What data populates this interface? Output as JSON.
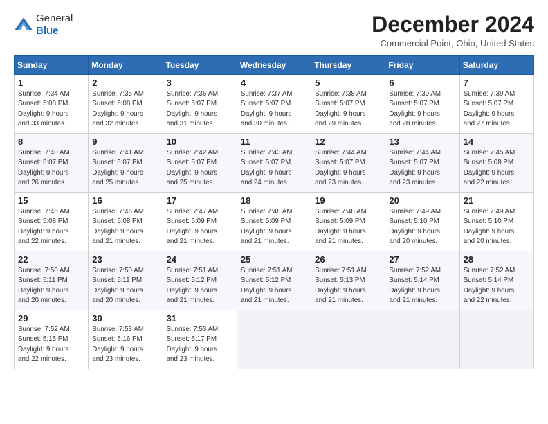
{
  "header": {
    "logo_general": "General",
    "logo_blue": "Blue",
    "month_title": "December 2024",
    "location": "Commercial Point, Ohio, United States"
  },
  "days_of_week": [
    "Sunday",
    "Monday",
    "Tuesday",
    "Wednesday",
    "Thursday",
    "Friday",
    "Saturday"
  ],
  "weeks": [
    [
      {
        "day": 1,
        "info": "Sunrise: 7:34 AM\nSunset: 5:08 PM\nDaylight: 9 hours\nand 33 minutes."
      },
      {
        "day": 2,
        "info": "Sunrise: 7:35 AM\nSunset: 5:08 PM\nDaylight: 9 hours\nand 32 minutes."
      },
      {
        "day": 3,
        "info": "Sunrise: 7:36 AM\nSunset: 5:07 PM\nDaylight: 9 hours\nand 31 minutes."
      },
      {
        "day": 4,
        "info": "Sunrise: 7:37 AM\nSunset: 5:07 PM\nDaylight: 9 hours\nand 30 minutes."
      },
      {
        "day": 5,
        "info": "Sunrise: 7:38 AM\nSunset: 5:07 PM\nDaylight: 9 hours\nand 29 minutes."
      },
      {
        "day": 6,
        "info": "Sunrise: 7:39 AM\nSunset: 5:07 PM\nDaylight: 9 hours\nand 28 minutes."
      },
      {
        "day": 7,
        "info": "Sunrise: 7:39 AM\nSunset: 5:07 PM\nDaylight: 9 hours\nand 27 minutes."
      }
    ],
    [
      {
        "day": 8,
        "info": "Sunrise: 7:40 AM\nSunset: 5:07 PM\nDaylight: 9 hours\nand 26 minutes."
      },
      {
        "day": 9,
        "info": "Sunrise: 7:41 AM\nSunset: 5:07 PM\nDaylight: 9 hours\nand 25 minutes."
      },
      {
        "day": 10,
        "info": "Sunrise: 7:42 AM\nSunset: 5:07 PM\nDaylight: 9 hours\nand 25 minutes."
      },
      {
        "day": 11,
        "info": "Sunrise: 7:43 AM\nSunset: 5:07 PM\nDaylight: 9 hours\nand 24 minutes."
      },
      {
        "day": 12,
        "info": "Sunrise: 7:44 AM\nSunset: 5:07 PM\nDaylight: 9 hours\nand 23 minutes."
      },
      {
        "day": 13,
        "info": "Sunrise: 7:44 AM\nSunset: 5:07 PM\nDaylight: 9 hours\nand 23 minutes."
      },
      {
        "day": 14,
        "info": "Sunrise: 7:45 AM\nSunset: 5:08 PM\nDaylight: 9 hours\nand 22 minutes."
      }
    ],
    [
      {
        "day": 15,
        "info": "Sunrise: 7:46 AM\nSunset: 5:08 PM\nDaylight: 9 hours\nand 22 minutes."
      },
      {
        "day": 16,
        "info": "Sunrise: 7:46 AM\nSunset: 5:08 PM\nDaylight: 9 hours\nand 21 minutes."
      },
      {
        "day": 17,
        "info": "Sunrise: 7:47 AM\nSunset: 5:09 PM\nDaylight: 9 hours\nand 21 minutes."
      },
      {
        "day": 18,
        "info": "Sunrise: 7:48 AM\nSunset: 5:09 PM\nDaylight: 9 hours\nand 21 minutes."
      },
      {
        "day": 19,
        "info": "Sunrise: 7:48 AM\nSunset: 5:09 PM\nDaylight: 9 hours\nand 21 minutes."
      },
      {
        "day": 20,
        "info": "Sunrise: 7:49 AM\nSunset: 5:10 PM\nDaylight: 9 hours\nand 20 minutes."
      },
      {
        "day": 21,
        "info": "Sunrise: 7:49 AM\nSunset: 5:10 PM\nDaylight: 9 hours\nand 20 minutes."
      }
    ],
    [
      {
        "day": 22,
        "info": "Sunrise: 7:50 AM\nSunset: 5:11 PM\nDaylight: 9 hours\nand 20 minutes."
      },
      {
        "day": 23,
        "info": "Sunrise: 7:50 AM\nSunset: 5:11 PM\nDaylight: 9 hours\nand 20 minutes."
      },
      {
        "day": 24,
        "info": "Sunrise: 7:51 AM\nSunset: 5:12 PM\nDaylight: 9 hours\nand 21 minutes."
      },
      {
        "day": 25,
        "info": "Sunrise: 7:51 AM\nSunset: 5:12 PM\nDaylight: 9 hours\nand 21 minutes."
      },
      {
        "day": 26,
        "info": "Sunrise: 7:51 AM\nSunset: 5:13 PM\nDaylight: 9 hours\nand 21 minutes."
      },
      {
        "day": 27,
        "info": "Sunrise: 7:52 AM\nSunset: 5:14 PM\nDaylight: 9 hours\nand 21 minutes."
      },
      {
        "day": 28,
        "info": "Sunrise: 7:52 AM\nSunset: 5:14 PM\nDaylight: 9 hours\nand 22 minutes."
      }
    ],
    [
      {
        "day": 29,
        "info": "Sunrise: 7:52 AM\nSunset: 5:15 PM\nDaylight: 9 hours\nand 22 minutes."
      },
      {
        "day": 30,
        "info": "Sunrise: 7:53 AM\nSunset: 5:16 PM\nDaylight: 9 hours\nand 23 minutes."
      },
      {
        "day": 31,
        "info": "Sunrise: 7:53 AM\nSunset: 5:17 PM\nDaylight: 9 hours\nand 23 minutes."
      },
      null,
      null,
      null,
      null
    ]
  ]
}
